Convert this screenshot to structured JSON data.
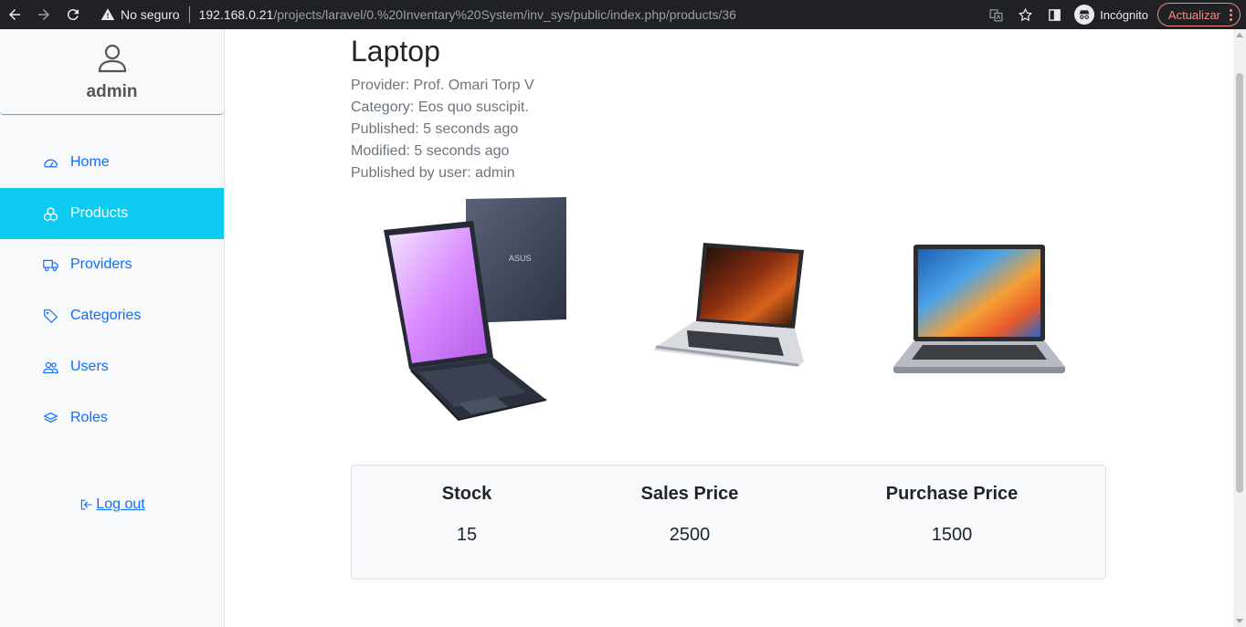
{
  "browser": {
    "security_label": "No seguro",
    "url_host": "192.168.0.21",
    "url_path": "/projects/laravel/0.%20Inventary%20System/inv_sys/public/index.php/products/36",
    "incognito_label": "Incógnito",
    "update_label": "Actualizar"
  },
  "sidebar": {
    "username": "admin",
    "items": [
      {
        "label": "Home",
        "icon": "dashboard-icon"
      },
      {
        "label": "Products",
        "icon": "boxes-icon",
        "active": true
      },
      {
        "label": "Providers",
        "icon": "truck-icon"
      },
      {
        "label": "Categories",
        "icon": "tag-icon"
      },
      {
        "label": "Users",
        "icon": "users-icon"
      },
      {
        "label": "Roles",
        "icon": "layers-icon"
      }
    ],
    "logout_label": " Log out"
  },
  "product": {
    "title": "Laptop",
    "provider": "Provider: Prof. Omari Torp V",
    "category": "Category: Eos quo suscipit.",
    "published": "Published: 5 seconds ago",
    "modified": "Modified: 5 seconds ago",
    "published_by": "Published by user: admin"
  },
  "stats": {
    "stock_label": "Stock",
    "stock_value": "15",
    "sales_label": "Sales Price",
    "sales_value": "2500",
    "purchase_label": "Purchase Price",
    "purchase_value": "1500"
  },
  "colors": {
    "accent": "#0dcaf0",
    "link": "#0d6efd",
    "chrome_bg": "#202124"
  }
}
